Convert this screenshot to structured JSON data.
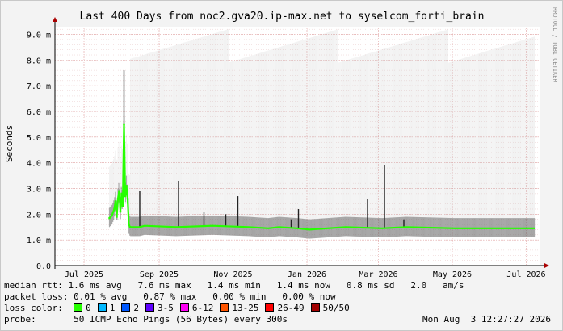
{
  "chart_data": {
    "type": "area",
    "title": "Last 400 Days from noc2.gva20.ip-max.net to syselcom_forti_brain",
    "ylabel": "Seconds",
    "watermark": "RRDTOOL / TOBI OETIKER",
    "ylim": [
      0,
      9.3
    ],
    "y_ticks": [
      {
        "v": 0,
        "label": "0.0"
      },
      {
        "v": 1,
        "label": "1.0 m"
      },
      {
        "v": 2,
        "label": "2.0 m"
      },
      {
        "v": 3,
        "label": "3.0 m"
      },
      {
        "v": 4,
        "label": "4.0 m"
      },
      {
        "v": 5,
        "label": "5.0 m"
      },
      {
        "v": 6,
        "label": "6.0 m"
      },
      {
        "v": 7,
        "label": "7.0 m"
      },
      {
        "v": 8,
        "label": "8.0 m"
      },
      {
        "v": 9,
        "label": "9.0 m"
      }
    ],
    "x_range_days": [
      0,
      400
    ],
    "x_ticks": [
      {
        "d": 24,
        "label": "Jul 2025"
      },
      {
        "d": 86,
        "label": "Sep 2025"
      },
      {
        "d": 147,
        "label": "Nov 2025"
      },
      {
        "d": 208,
        "label": "Jan 2026"
      },
      {
        "d": 267,
        "label": "Mar 2026"
      },
      {
        "d": 328,
        "label": "May 2026"
      },
      {
        "d": 389,
        "label": "Jul 2026"
      }
    ],
    "median_rtt_series": [
      {
        "d": 45,
        "v": 1.85
      },
      {
        "d": 47,
        "v": 1.95
      },
      {
        "d": 49,
        "v": 2.2
      },
      {
        "d": 50,
        "v": 2.5
      },
      {
        "d": 51,
        "v": 1.9
      },
      {
        "d": 52,
        "v": 2.6
      },
      {
        "d": 53,
        "v": 2.9
      },
      {
        "d": 54,
        "v": 2.1
      },
      {
        "d": 55,
        "v": 2.8
      },
      {
        "d": 56,
        "v": 2.3
      },
      {
        "d": 57,
        "v": 5.5
      },
      {
        "d": 58,
        "v": 2.7
      },
      {
        "d": 59,
        "v": 3.1
      },
      {
        "d": 60,
        "v": 2.6
      },
      {
        "d": 61,
        "v": 1.6
      },
      {
        "d": 62,
        "v": 1.5
      },
      {
        "d": 70,
        "v": 1.5
      },
      {
        "d": 74,
        "v": 1.55
      },
      {
        "d": 100,
        "v": 1.5
      },
      {
        "d": 130,
        "v": 1.55
      },
      {
        "d": 160,
        "v": 1.5
      },
      {
        "d": 176,
        "v": 1.45
      },
      {
        "d": 185,
        "v": 1.5
      },
      {
        "d": 200,
        "v": 1.45
      },
      {
        "d": 210,
        "v": 1.4
      },
      {
        "d": 225,
        "v": 1.45
      },
      {
        "d": 240,
        "v": 1.5
      },
      {
        "d": 270,
        "v": 1.45
      },
      {
        "d": 290,
        "v": 1.5
      },
      {
        "d": 330,
        "v": 1.45
      },
      {
        "d": 360,
        "v": 1.45
      },
      {
        "d": 396,
        "v": 1.45
      }
    ],
    "spikes": [
      {
        "d": 57,
        "v": 7.6
      },
      {
        "d": 70,
        "v": 2.9
      },
      {
        "d": 102,
        "v": 3.3
      },
      {
        "d": 123,
        "v": 2.1
      },
      {
        "d": 141,
        "v": 2.0
      },
      {
        "d": 151,
        "v": 2.7
      },
      {
        "d": 195,
        "v": 1.8
      },
      {
        "d": 201,
        "v": 2.2
      },
      {
        "d": 258,
        "v": 2.6
      },
      {
        "d": 272,
        "v": 3.9
      },
      {
        "d": 288,
        "v": 1.8
      }
    ]
  },
  "legend": {
    "median_label": "median rtt:",
    "median_values": " 1.6 ms avg   7.6 ms max   1.4 ms min   1.4 ms now   0.8 ms sd   2.0   am/s",
    "packet_label": "packet loss:",
    "packet_values": " 0.01 % avg   0.87 % max   0.00 % min   0.00 % now",
    "loss_label": "loss color:",
    "loss_items": [
      {
        "label": "0",
        "color": "#26ff00"
      },
      {
        "label": "1",
        "color": "#00b8ff"
      },
      {
        "label": "2",
        "color": "#0059ff"
      },
      {
        "label": "3-5",
        "color": "#5e00ff"
      },
      {
        "label": "6-12",
        "color": "#ff00f5"
      },
      {
        "label": "13-25",
        "color": "#ff5500"
      },
      {
        "label": "26-49",
        "color": "#ff0000"
      },
      {
        "label": "50/50",
        "color": "#a10000"
      }
    ],
    "probe_label": "probe:",
    "probe_value": "       50 ICMP Echo Pings (56 Bytes) every 300s",
    "timestamp": "Mon Aug  3 12:27:27 2026"
  }
}
